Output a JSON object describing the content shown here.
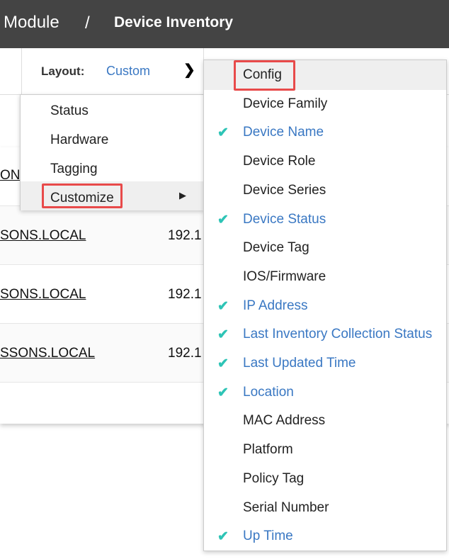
{
  "header": {
    "module": "Module",
    "separator": "/",
    "page": "Device Inventory"
  },
  "toolbar": {
    "layout_label": "Layout:",
    "layout_value": "Custom"
  },
  "rows": [
    {
      "name": "ON",
      "ip": ""
    },
    {
      "name": "SONS.LOCAL",
      "ip": "192.1"
    },
    {
      "name": "SONS.LOCAL",
      "ip": "192.1"
    },
    {
      "name": "SSONS.LOCAL",
      "ip": "192.1"
    }
  ],
  "layout_menu": [
    "Status",
    "Hardware",
    "Tagging",
    "Customize"
  ],
  "columns_menu": [
    {
      "label": "Config",
      "checked": false
    },
    {
      "label": "Device Family",
      "checked": false
    },
    {
      "label": "Device Name",
      "checked": true
    },
    {
      "label": "Device Role",
      "checked": false
    },
    {
      "label": "Device Series",
      "checked": false
    },
    {
      "label": "Device Status",
      "checked": true
    },
    {
      "label": "Device Tag",
      "checked": false
    },
    {
      "label": "IOS/Firmware",
      "checked": false
    },
    {
      "label": "IP Address",
      "checked": true
    },
    {
      "label": "Last Inventory Collection Status",
      "checked": true
    },
    {
      "label": "Last Updated Time",
      "checked": true
    },
    {
      "label": "Location",
      "checked": true
    },
    {
      "label": "MAC Address",
      "checked": false
    },
    {
      "label": "Platform",
      "checked": false
    },
    {
      "label": "Policy Tag",
      "checked": false
    },
    {
      "label": "Serial Number",
      "checked": false
    },
    {
      "label": "Up Time",
      "checked": true
    }
  ],
  "colors": {
    "header": "#444444",
    "accent": "#3a78c3",
    "check": "#2ec4b6",
    "highlight_box": "#e84a4a"
  }
}
